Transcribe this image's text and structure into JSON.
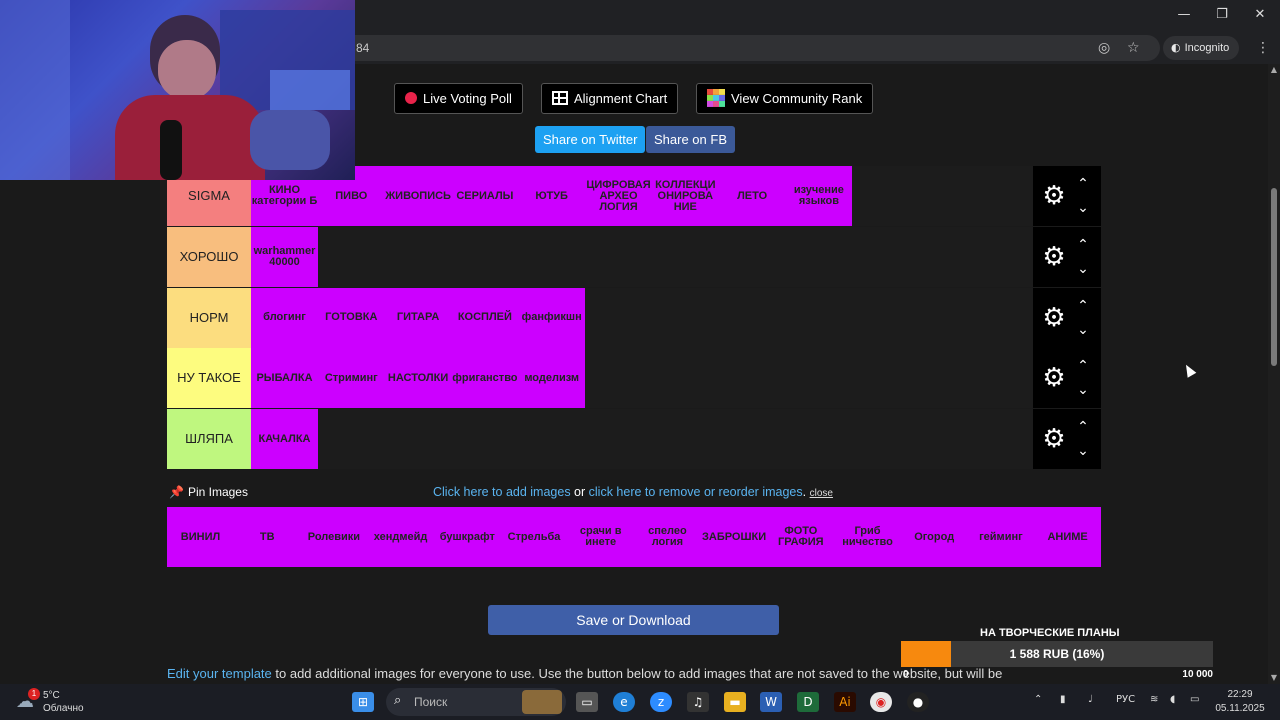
{
  "browser": {
    "url_fragment": "84",
    "incognito_label": "Incognito",
    "minimize": "—",
    "restore": "❐",
    "close": "✕"
  },
  "top_buttons": {
    "live_poll": "Live Voting Poll",
    "alignment": "Alignment Chart",
    "community_rank": "View Community Rank"
  },
  "share": {
    "twitter": "Share on Twitter",
    "fb": "Share on FB",
    "twitter_color": "#1da1f2",
    "fb_color": "#3b5998"
  },
  "tiers": [
    {
      "label": "SIGMA",
      "color": "#f47f7f",
      "items": [
        "КИНО категории Б",
        "ПИВО",
        "ЖИВОПИСЬ",
        "СЕРИАЛЫ",
        "ЮТУБ",
        "ЦИФРОВАЯ АРХЕО ЛОГИЯ",
        "КОЛЛЕКЦИ ОНИРОВА НИЕ",
        "ЛЕТО",
        "изучение языков"
      ]
    },
    {
      "label": "ХОРОШО",
      "color": "#f8be7e",
      "items": [
        "warhammer 40000"
      ]
    },
    {
      "label": "НОРМ",
      "color": "#fcdd7f",
      "items": [
        "блогинг",
        "ГОТОВКА",
        "ГИТАРА",
        "КОСПЛЕЙ",
        "фанфикшн"
      ]
    },
    {
      "label": "НУ ТАКОЕ",
      "color": "#fdfc7f",
      "items": [
        "РЫБАЛКА",
        "Стриминг",
        "НАСТОЛКИ",
        "фриганство",
        "моделизм"
      ]
    },
    {
      "label": "ШЛЯПА",
      "color": "#bff77f",
      "items": [
        "КАЧАЛКА"
      ]
    }
  ],
  "pin": {
    "label": "Pin Images",
    "link_add": "Click here to add images",
    "or": " or ",
    "link_remove": "click here to remove or reorder images",
    "dot": ".",
    "close": "close"
  },
  "pool_items": [
    "ВИНИЛ",
    "ТВ",
    "Ролевики",
    "хендмейд",
    "бушкрафт",
    "Стрельба",
    "срачи в инете",
    "спелео логия",
    "ЗАБРОШКИ",
    "ФОТО ГРАФИЯ",
    "Гриб ничество",
    "Огород",
    "гейминг",
    "АНИМЕ"
  ],
  "save_button": "Save or Download",
  "bottom": {
    "link": "Edit your template",
    "text": " to add additional images for everyone to use. Use the button below to add images that are not saved to the website, but will be"
  },
  "donation": {
    "title": "НА ТВОРЧЕСКИЕ ПЛАНЫ",
    "amount": "1 588 RUB (16%)",
    "progress": 0.16,
    "min": "0",
    "max": "10 000",
    "fill_color": "#f7890e"
  },
  "taskbar": {
    "weather_temp": "5°C",
    "weather_desc": "Облачно",
    "weather_badge": "1",
    "search_placeholder": "Поиск",
    "lang": "РУС",
    "time": "22:29",
    "date": "05.11.2025"
  }
}
